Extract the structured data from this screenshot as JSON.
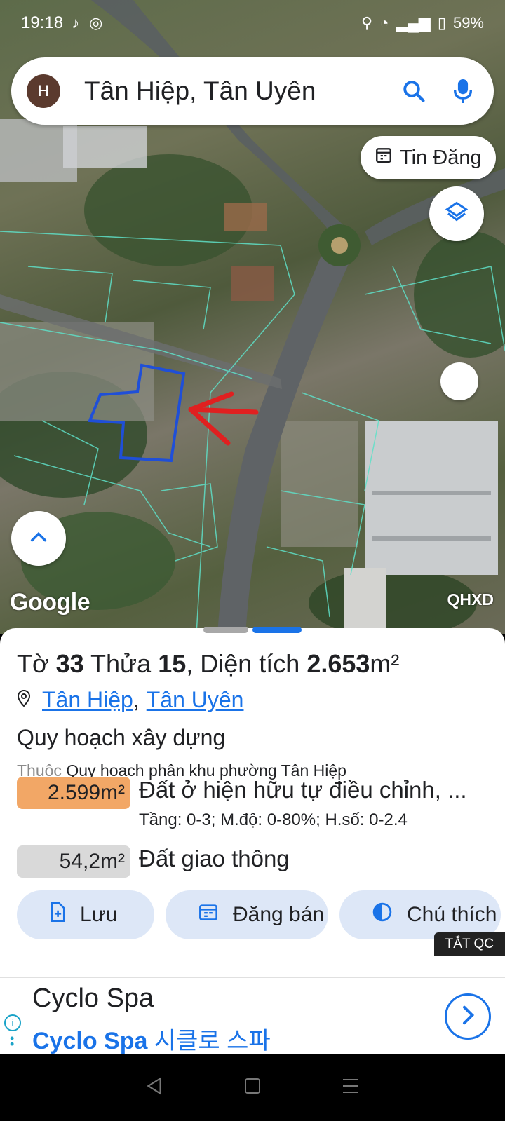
{
  "status_bar": {
    "time": "19:18",
    "battery": "59%"
  },
  "search": {
    "avatar_letter": "H",
    "query": "Tân Hiệp, Tân Uyên"
  },
  "map": {
    "tin_dang_label": "Tin Đăng",
    "google_label": "Google",
    "layer_label": "QHXD"
  },
  "parcel": {
    "to_label": "Tờ",
    "to_number": "33",
    "thua_label": "Thửa",
    "thua_number": "15",
    "area_label": ", Diện tích",
    "area_value": "2.653",
    "area_unit": "m²",
    "ward_link": "Tân Hiệp",
    "separator": ",",
    "district_link": "Tân Uyên"
  },
  "planning": {
    "section_title": "Quy hoạch xây dựng",
    "belongs_prefix": "Thuộc",
    "belongs_value": "Quy hoạch phân khu phường Tân Hiệp",
    "zones": [
      {
        "area": "2.599m²",
        "name": "Đất ở hiện hữu tự điều chỉnh, ...",
        "detail": "Tầng: 0-3; M.độ: 0-80%; H.số: 0-2.4",
        "color": "#f2a766"
      },
      {
        "area": "54,2m²",
        "name": "Đất giao thông",
        "detail": "",
        "color": "#d9d9d9"
      }
    ]
  },
  "actions": {
    "save": "Lưu",
    "post": "Đăng bán",
    "legend": "Chú thích"
  },
  "ad": {
    "toggle_label": "TẮT QC",
    "title": "Cyclo Spa",
    "subtitle_latin": "Cyclo Spa",
    "subtitle_korean": "시클로 스파"
  },
  "colors": {
    "accent": "#1a73e8",
    "parcel_outline": "#1f4fd8",
    "arrow": "#e02020",
    "cadastral": "#5fe0c8"
  }
}
